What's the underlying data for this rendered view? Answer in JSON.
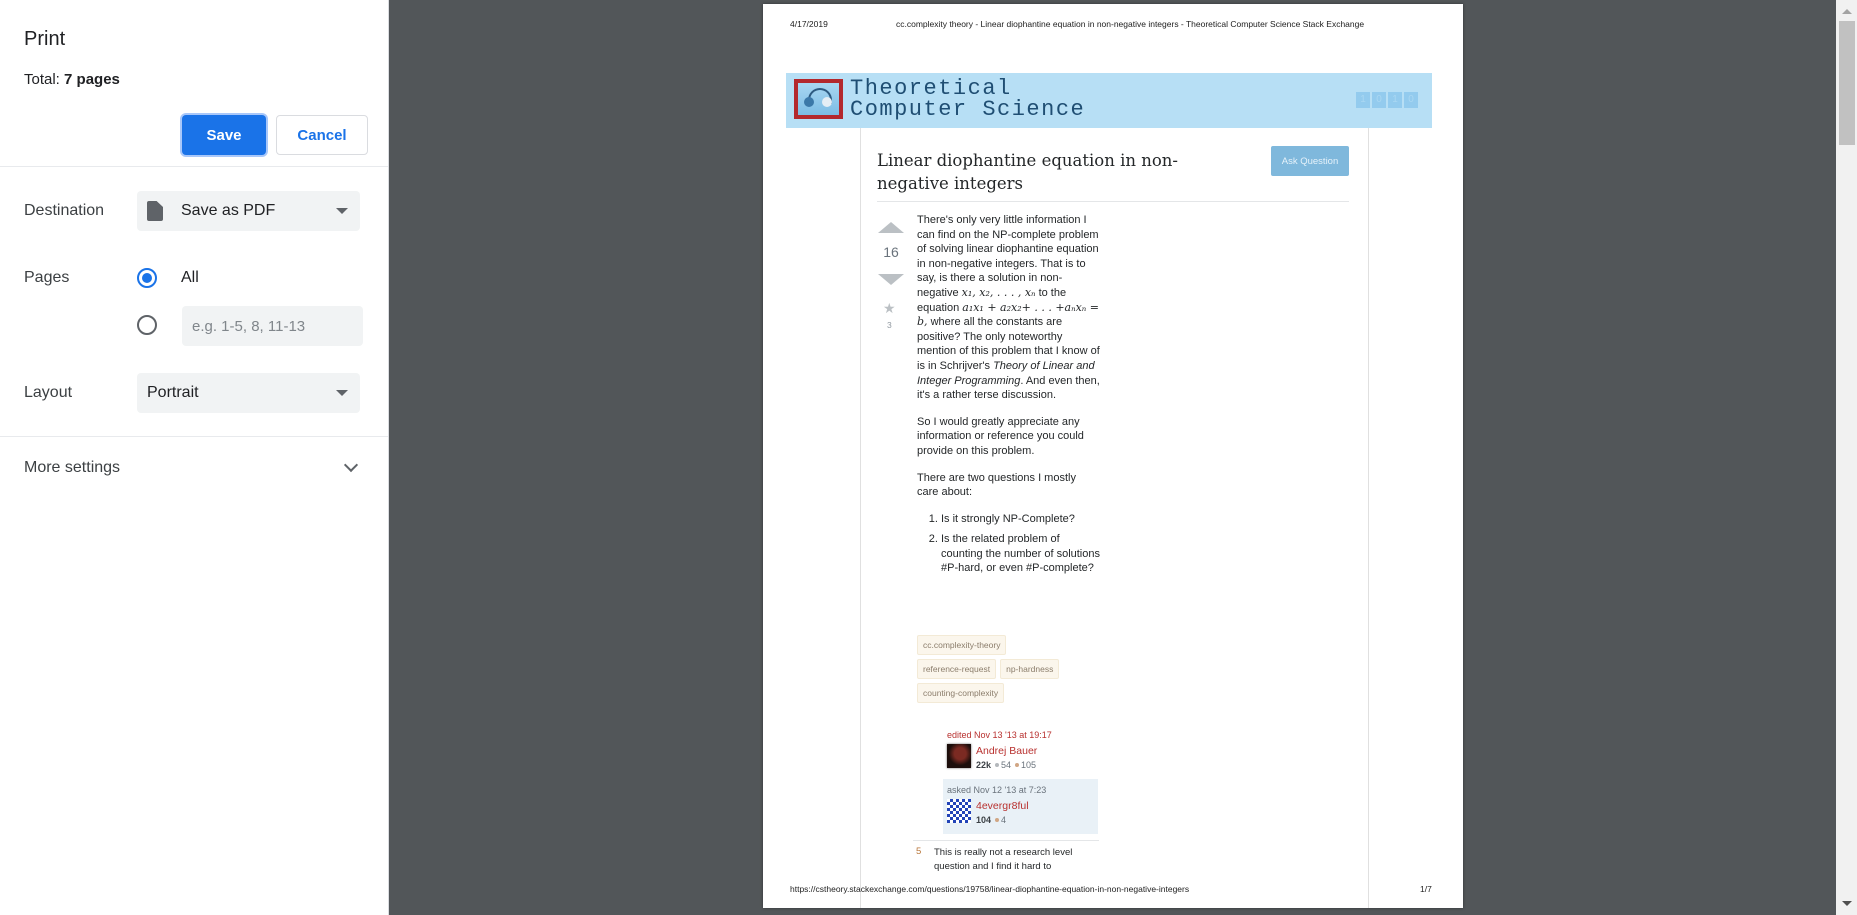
{
  "print_panel": {
    "title": "Print",
    "total_label": "Total:",
    "total_value": "7 pages",
    "save_label": "Save",
    "cancel_label": "Cancel",
    "destination": {
      "label": "Destination",
      "value": "Save as PDF",
      "icon": "document-icon"
    },
    "pages": {
      "label": "Pages",
      "option_all": "All",
      "selected": "All",
      "custom_placeholder": "e.g. 1-5, 8, 11-13",
      "custom_value": ""
    },
    "layout": {
      "label": "Layout",
      "value": "Portrait"
    },
    "more_settings_label": "More settings"
  },
  "preview": {
    "header_date": "4/17/2019",
    "header_title": "cc.complexity theory - Linear diophantine equation in non-negative integers - Theoretical Computer Science Stack Exchange",
    "site_name": "Theoretical\nComputer Science",
    "banner_bits": [
      "1",
      "0",
      "1",
      "0"
    ],
    "question_title": "Linear diophantine equation in non-negative integers",
    "ask_button": "Ask Question",
    "vote_count": "16",
    "favorite_count": "3",
    "body": {
      "p1_a": "There's only very little information I can find on the NP-complete problem of solving linear diophantine equation in non-negative integers. That is to say, is there a solution in non-negative ",
      "p1_math1": "x₁, x₂, . . . , xₙ",
      "p1_b": " to the equation ",
      "p1_math2": "a₁x₁ + a₂x₂+ . . . +aₙxₙ = b,",
      "p1_c": " where all the constants are positive? The only noteworthy mention of this problem that I know of is in Schrijver's ",
      "p1_book": "Theory of Linear and Integer Programming",
      "p1_d": ". And even then, it's a rather terse discussion.",
      "p2": "So I would greatly appreciate any information or reference you could provide on this problem.",
      "p3": "There are two questions I mostly care about:",
      "list": [
        "Is it strongly NP-Complete?",
        "Is the related problem of counting the number of solutions #P-hard, or even #P-complete?"
      ]
    },
    "tags": [
      "cc.complexity-theory",
      "reference-request",
      "np-hardness",
      "counting-complexity"
    ],
    "editor": {
      "when": "edited Nov 13 '13 at 19:17",
      "name": "Andrej Bauer",
      "rep": "22k",
      "silver": "54",
      "bronze": "105"
    },
    "asker": {
      "when": "asked Nov 12 '13 at 7:23",
      "name": "4evergr8ful",
      "rep": "104",
      "bronze": "4"
    },
    "comment": {
      "score": "5",
      "text": "This is really not a research level question and I find it hard to"
    },
    "footer_url": "https://cstheory.stackexchange.com/questions/19758/linear-diophantine-equation-in-non-negative-integers",
    "footer_page": "1/7"
  },
  "colors": {
    "accent": "#1a73e8",
    "preview_background": "#525659",
    "banner": "#b7dff5",
    "link_red": "#b8312f"
  }
}
